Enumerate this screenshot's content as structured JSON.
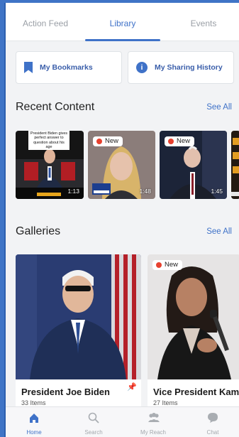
{
  "tabs": [
    {
      "label": "Action Feed",
      "active": false
    },
    {
      "label": "Library",
      "active": true
    },
    {
      "label": "Events",
      "active": false
    }
  ],
  "library_buttons": {
    "bookmarks": "My Bookmarks",
    "sharing_history": "My Sharing History",
    "info_glyph": "i"
  },
  "recent": {
    "title": "Recent Content",
    "see_all": "See All",
    "items": [
      {
        "caption": "President Biden gives perfect answer to question about his age",
        "duration": "1:13",
        "new": false
      },
      {
        "badge": "New",
        "duration": "1:48",
        "new": true
      },
      {
        "badge": "New",
        "duration": "1:45",
        "new": true
      }
    ]
  },
  "galleries": {
    "title": "Galleries",
    "see_all": "See All",
    "items": [
      {
        "name": "President Joe Biden",
        "count": "33 Items",
        "badge": ""
      },
      {
        "name": "Vice President Kamala Harris",
        "count": "27 Items",
        "badge": "New"
      }
    ]
  },
  "bottom_nav": [
    {
      "label": "Home",
      "icon": "home-icon",
      "active": true
    },
    {
      "label": "Search",
      "icon": "search-icon",
      "active": false
    },
    {
      "label": "My Reach",
      "icon": "people-icon",
      "active": false
    },
    {
      "label": "Chat",
      "icon": "chat-icon",
      "active": false
    }
  ],
  "colors": {
    "accent": "#3f72c8",
    "badge_dot": "#e7412f",
    "outer_background": "#3f74c6"
  }
}
